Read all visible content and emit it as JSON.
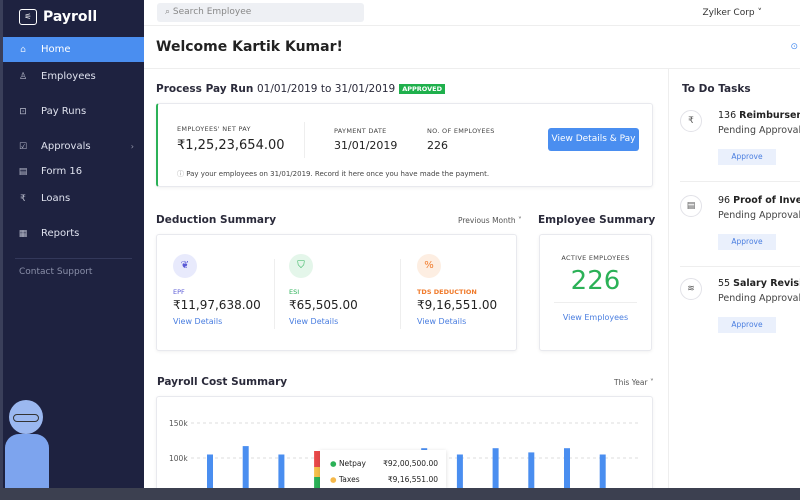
{
  "app": {
    "name": "Payroll"
  },
  "sidebar": {
    "items": [
      {
        "label": "Home",
        "icon": "home-icon"
      },
      {
        "label": "Employees",
        "icon": "user-icon"
      },
      {
        "label": "Pay Runs",
        "icon": "payrun-icon"
      },
      {
        "label": "Approvals",
        "icon": "checklist-icon"
      },
      {
        "label": "Form 16",
        "icon": "form-icon"
      },
      {
        "label": "Loans",
        "icon": "rupee-icon"
      },
      {
        "label": "Reports",
        "icon": "reports-icon"
      }
    ],
    "support": "Contact Support"
  },
  "topbar": {
    "search_placeholder": "Search Employee",
    "org": "Zylker Corp"
  },
  "welcome": "Welcome Kartik Kumar!",
  "payrun": {
    "title": "Process Pay Run",
    "period": "01/01/2019 to 31/01/2019",
    "status": "APPROVED",
    "net_pay_label": "EMPLOYEES' NET PAY",
    "net_pay": "₹1,25,23,654.00",
    "payment_date_label": "PAYMENT DATE",
    "payment_date": "31/01/2019",
    "employees_label": "NO. OF EMPLOYEES",
    "employees": "226",
    "button": "View Details & Pay",
    "note": "Pay your employees on 31/01/2019. Record it here once you have made the payment."
  },
  "deduction": {
    "title": "Deduction Summary",
    "filter": "Previous Month",
    "items": [
      {
        "label": "EPF",
        "value": "₹11,97,638.00",
        "link": "View Details",
        "color": "#5a5ad6"
      },
      {
        "label": "ESI",
        "value": "₹65,505.00",
        "link": "View Details",
        "color": "#2bb157"
      },
      {
        "label": "TDS DEDUCTION",
        "value": "₹9,16,551.00",
        "link": "View Details",
        "color": "#f07a2a"
      }
    ]
  },
  "employee_summary": {
    "title": "Employee Summary",
    "label": "ACTIVE EMPLOYEES",
    "count": "226",
    "link": "View Employees"
  },
  "todo": {
    "title": "To Do Tasks",
    "tasks": [
      {
        "count": "136",
        "name": "Reimbursemen",
        "status": "Pending Approval",
        "action": "Approve"
      },
      {
        "count": "96",
        "name": "Proof of Investr",
        "status": "Pending Approval",
        "action": "Approve"
      },
      {
        "count": "55",
        "name": "Salary Revision",
        "status": "Pending Approval",
        "action": "Approve"
      }
    ]
  },
  "payroll_cost": {
    "title": "Payroll Cost Summary",
    "filter": "This Year",
    "tooltip": [
      {
        "label": "Netpay",
        "value": "₹92,00,500.00",
        "color": "#2bb157"
      },
      {
        "label": "Taxes",
        "value": "₹9,16,551.00",
        "color": "#f5b84a"
      }
    ]
  },
  "chart_data": {
    "type": "bar",
    "yticks": [
      "150k",
      "100k"
    ],
    "values": [
      105000,
      117000,
      105000,
      110000,
      null,
      null,
      114000,
      105000,
      114000,
      108000,
      114000,
      105000
    ],
    "bar_color": "#4a8ef0",
    "stacked_colors": [
      "#e84848",
      "#f5c04a",
      "#2bb157"
    ],
    "grid": true
  }
}
